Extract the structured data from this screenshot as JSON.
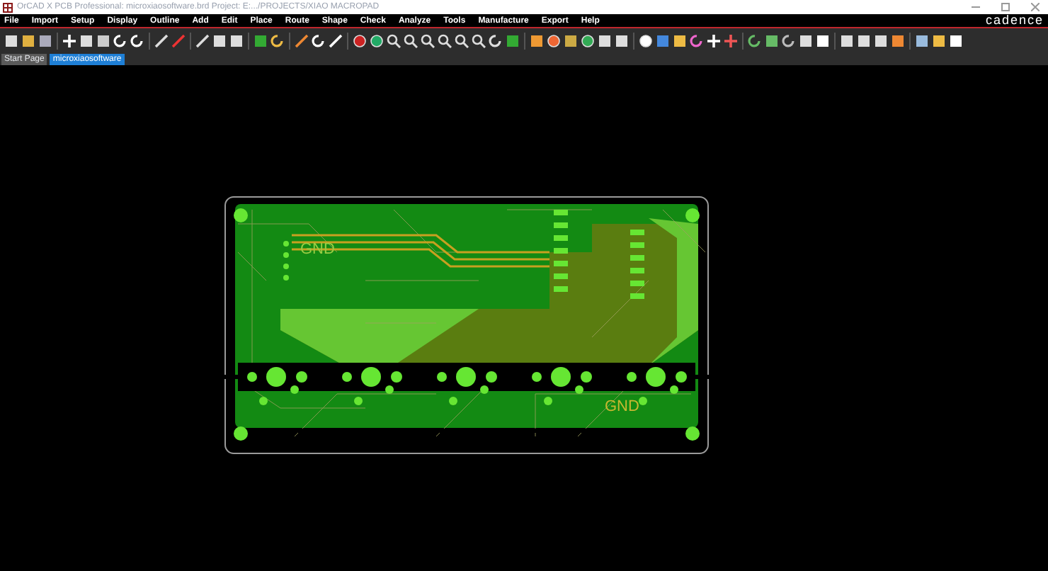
{
  "window": {
    "title": "OrCAD X PCB Professional: microxiaosoftware.brd  Project: E:.../PROJECTS/XIAO MACROPAD",
    "brand": "cadence"
  },
  "menu": [
    "File",
    "Import",
    "Setup",
    "Display",
    "Outline",
    "Add",
    "Edit",
    "Place",
    "Route",
    "Shape",
    "Check",
    "Analyze",
    "Tools",
    "Manufacture",
    "Export",
    "Help"
  ],
  "tabs": [
    {
      "label": "Start Page",
      "selected": false
    },
    {
      "label": "microxiaosoftware",
      "selected": true
    }
  ],
  "board": {
    "labels": [
      "GND",
      "GND"
    ]
  }
}
